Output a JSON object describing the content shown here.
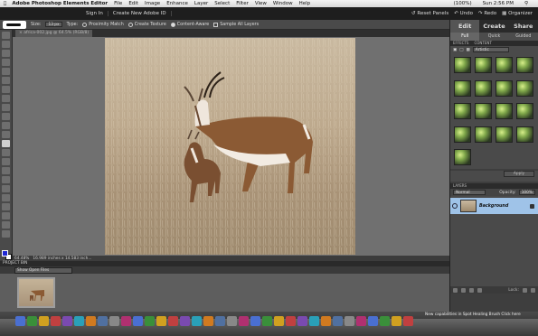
{
  "mac_menu": {
    "app": "Adobe Photoshop Elements Editor",
    "items": [
      "File",
      "Edit",
      "Image",
      "Enhance",
      "Layer",
      "Select",
      "Filter",
      "View",
      "Window",
      "Help"
    ],
    "battery": "(100%)",
    "clock": "Sun 2:56 PM"
  },
  "titlebar": {
    "sign_in": "Sign In",
    "create_id": "Create New Adobe ID",
    "reset_panels": "Reset Panels",
    "undo": "Undo",
    "redo": "Redo",
    "organizer": "Organizer"
  },
  "options": {
    "size_label": "Size:",
    "size_value": "13 px",
    "type_label": "Type:",
    "type_options": [
      "Proximity Match",
      "Create Texture",
      "Content-Aware"
    ],
    "type_selected_index": 2,
    "sample_all_layers": "Sample All Layers"
  },
  "document": {
    "tab_label": "africa-002.jpg @ 64.5% (RGB/8)",
    "zoom": "64.48%",
    "dimensions": "16.989 inches x 14.583 inch..."
  },
  "project_bin": {
    "header": "PROJECT BIN",
    "dropdown": "Show Open Files"
  },
  "right_panel": {
    "modes": [
      "Edit",
      "Create",
      "Share"
    ],
    "active_mode": "Edit",
    "subtabs": [
      "Full",
      "Quick",
      "Guided"
    ],
    "active_subtab": "Full",
    "panel_tabs": [
      "EFFECTS",
      "CONTENT"
    ],
    "effects_filter": "Artistic",
    "apply_button": "Apply",
    "layers_header": "LAYERS",
    "blend_mode": "Normal",
    "opacity_label": "Opacity:",
    "opacity_value": "100%",
    "layer_name": "Background",
    "lock_label": "Lock:"
  },
  "dock": {
    "tip_text": "New capabilities in Spot Healing Brush Click here"
  },
  "colors": {
    "foreground": "#1f27d3",
    "background": "#ffffff",
    "accent": "#9fc3e8"
  }
}
